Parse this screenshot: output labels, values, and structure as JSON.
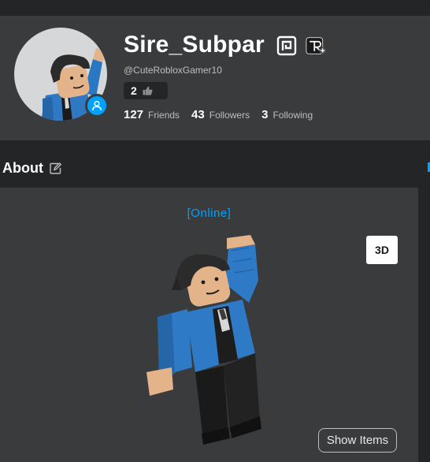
{
  "profile": {
    "display_name": "Sire_Subpar",
    "username_handle": "@CuteRobloxGamer10",
    "level_chip": {
      "value": "2",
      "icon": "thumbs-up-icon"
    },
    "stats": [
      {
        "value": "127",
        "label": "Friends"
      },
      {
        "value": "43",
        "label": "Followers"
      },
      {
        "value": "3",
        "label": "Following"
      }
    ],
    "badges": [
      "premium-badge-icon",
      "verified-creator-badge-icon"
    ],
    "presence_badge_icon": "user-presence-icon"
  },
  "about": {
    "title": "About",
    "edit_icon": "edit-icon"
  },
  "avatar_view": {
    "presence_text": "[Online]",
    "toggle_label": "3D",
    "show_items_label": "Show Items"
  },
  "colors": {
    "page_bg": "#232527",
    "card_bg": "#393b3d",
    "accent": "#00a2ff",
    "secondary_text": "#bdbebe"
  }
}
